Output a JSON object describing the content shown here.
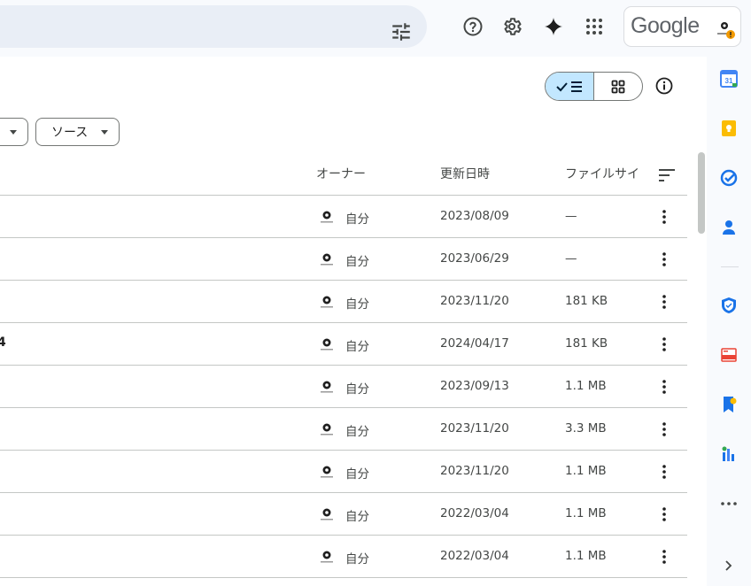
{
  "header": {
    "tune_icon": "tune-icon",
    "help_icon": "help-icon",
    "settings_icon": "gear-icon",
    "gemini_icon": "sparkle-icon",
    "apps_icon": "apps-grid-icon",
    "google_label": "Google"
  },
  "toolbar": {
    "view_list_icon": "list-view-icon",
    "view_grid_icon": "grid-view-icon",
    "info_icon": "info-icon"
  },
  "filters": {
    "source_label": "ソース"
  },
  "table": {
    "columns": {
      "owner": "オーナー",
      "modified": "更新日時",
      "size": "ファイルサイ"
    },
    "rows": [
      {
        "name_fragment": "",
        "owner": "自分",
        "date": "2023/08/09",
        "size": "—"
      },
      {
        "name_fragment": "",
        "owner": "自分",
        "date": "2023/06/29",
        "size": "—"
      },
      {
        "name_fragment": "",
        "owner": "自分",
        "date": "2023/11/20",
        "size": "181 KB"
      },
      {
        "name_fragment": "4",
        "owner": "自分",
        "date": "2024/04/17",
        "size": "181 KB"
      },
      {
        "name_fragment": "",
        "owner": "自分",
        "date": "2023/09/13",
        "size": "1.1 MB"
      },
      {
        "name_fragment": "",
        "owner": "自分",
        "date": "2023/11/20",
        "size": "3.3 MB"
      },
      {
        "name_fragment": "",
        "owner": "自分",
        "date": "2023/11/20",
        "size": "1.1 MB"
      },
      {
        "name_fragment": "",
        "owner": "自分",
        "date": "2022/03/04",
        "size": "1.1 MB"
      },
      {
        "name_fragment": "",
        "owner": "自分",
        "date": "2022/03/04",
        "size": "1.1 MB"
      }
    ]
  },
  "side_panel": {
    "calendar_label": "31",
    "icons": [
      "calendar-icon",
      "keep-icon",
      "tasks-icon",
      "contacts-icon",
      "shield-icon",
      "ocr-icon",
      "bookmark-icon",
      "chart-icon",
      "more-icon",
      "expand-icon"
    ]
  },
  "colors": {
    "accent_selected": "#c2e7ff",
    "search_bg": "#e9eef6",
    "divider": "#c4c7c5"
  }
}
